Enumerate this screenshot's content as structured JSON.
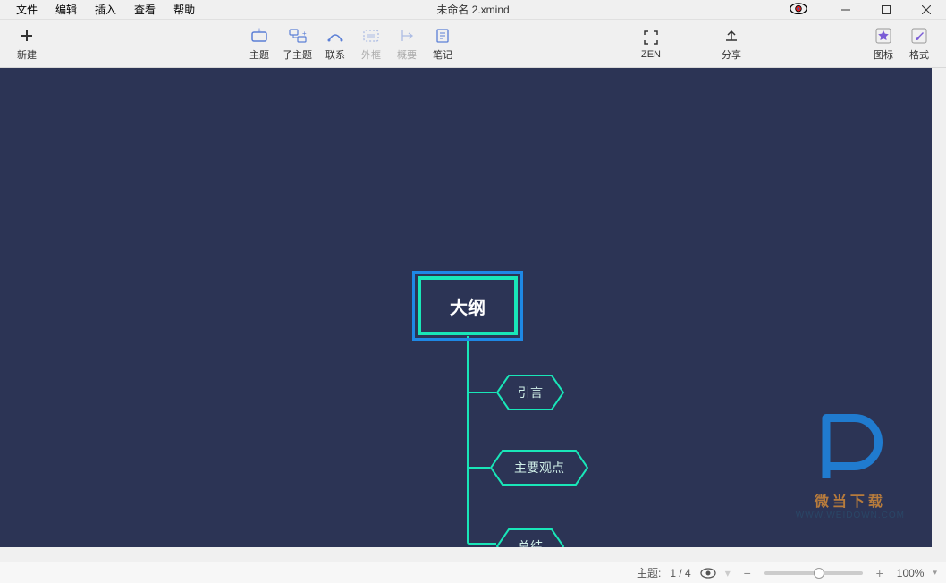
{
  "title": "未命名 2.xmind",
  "menu": {
    "file": "文件",
    "edit": "编辑",
    "insert": "插入",
    "view": "查看",
    "help": "帮助"
  },
  "toolbar": {
    "new": "新建",
    "topic": "主题",
    "subtopic": "子主题",
    "relation": "联系",
    "boundary": "外框",
    "summary": "概要",
    "note": "笔记",
    "zen": "ZEN",
    "share": "分享",
    "icons": "图标",
    "format": "格式"
  },
  "mindmap": {
    "root": "大纲",
    "children": [
      "引言",
      "主要观点",
      "总结"
    ]
  },
  "statusbar": {
    "topic_label": "主题:",
    "topic_index": "1 / 4",
    "zoom": "100%"
  },
  "watermark": {
    "line1": "微当下载",
    "line2": "WWW.WEIDOWN.COM"
  },
  "colors": {
    "canvas_bg": "#2c3455",
    "node_border": "#19e6b8",
    "selection": "#1e88e5"
  }
}
